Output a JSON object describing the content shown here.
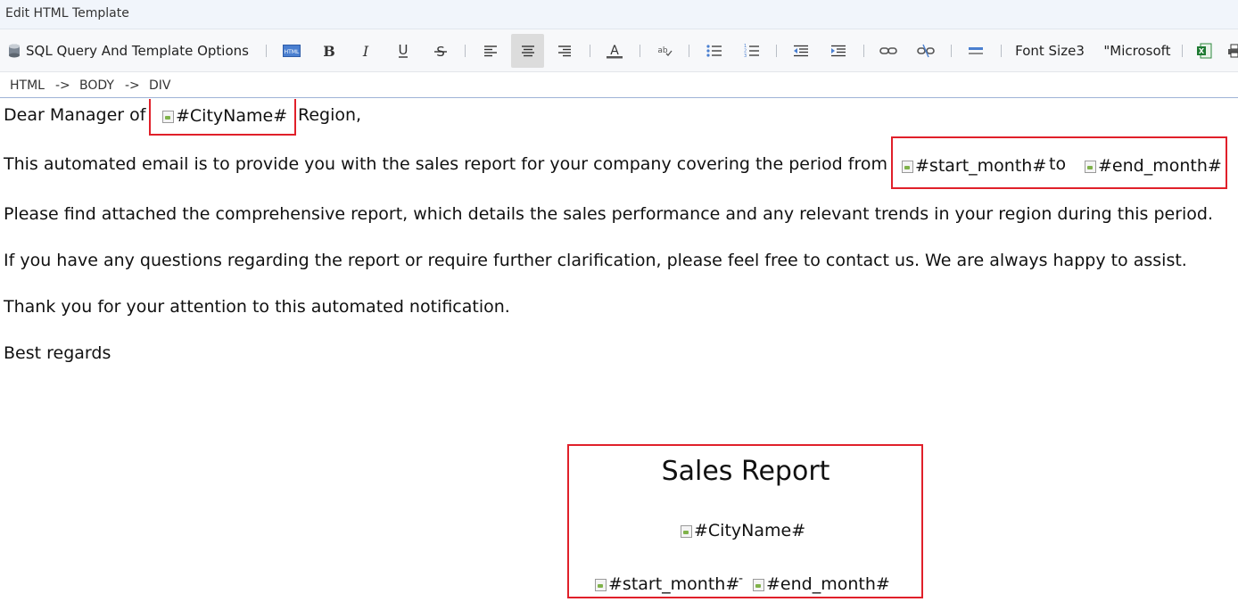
{
  "window": {
    "title": "Edit HTML Template"
  },
  "toolbar": {
    "sql_label": "SQL Query And Template Options",
    "font_size_label": "Font Size3",
    "font_name_label": "\"Microsoft",
    "icons": [
      "database-icon",
      "html-source-icon",
      "bold-icon",
      "italic-icon",
      "underline-icon",
      "strikethrough-icon",
      "align-left-icon",
      "align-center-icon",
      "align-right-icon",
      "font-color-icon",
      "spellcheck-icon",
      "bulleted-list-icon",
      "numbered-list-icon",
      "outdent-icon",
      "indent-icon",
      "link-icon",
      "unlink-icon",
      "horizontal-rule-icon",
      "excel-icon"
    ],
    "active": "align-center-icon",
    "accent_color": "#e0202a"
  },
  "breadcrumb": {
    "html": "HTML",
    "arrow": "->",
    "body": "BODY",
    "div": "DIV"
  },
  "content": {
    "greeting_prefix": "Dear Manager of",
    "greeting_suffix": "Region,",
    "city_placeholder": "#CityName#",
    "para1_text": "This automated email is to provide you with the sales report for your company covering the period from",
    "start_placeholder": "#start_month#",
    "to_word": "to",
    "end_placeholder": "#end_month#",
    "para2": "Please find attached the comprehensive report, which details the sales performance and any relevant trends in your region during this period.",
    "para3": "If you have any questions regarding the report or require further clarification, please feel free to contact us. We are always happy to assist.",
    "para4": "Thank you for your attention to this automated notification.",
    "closing": "Best regards",
    "report_title": "Sales Report",
    "report_city": "#CityName#",
    "report_start": "#start_month#",
    "report_dash": "-",
    "report_end": "#end_month#"
  }
}
